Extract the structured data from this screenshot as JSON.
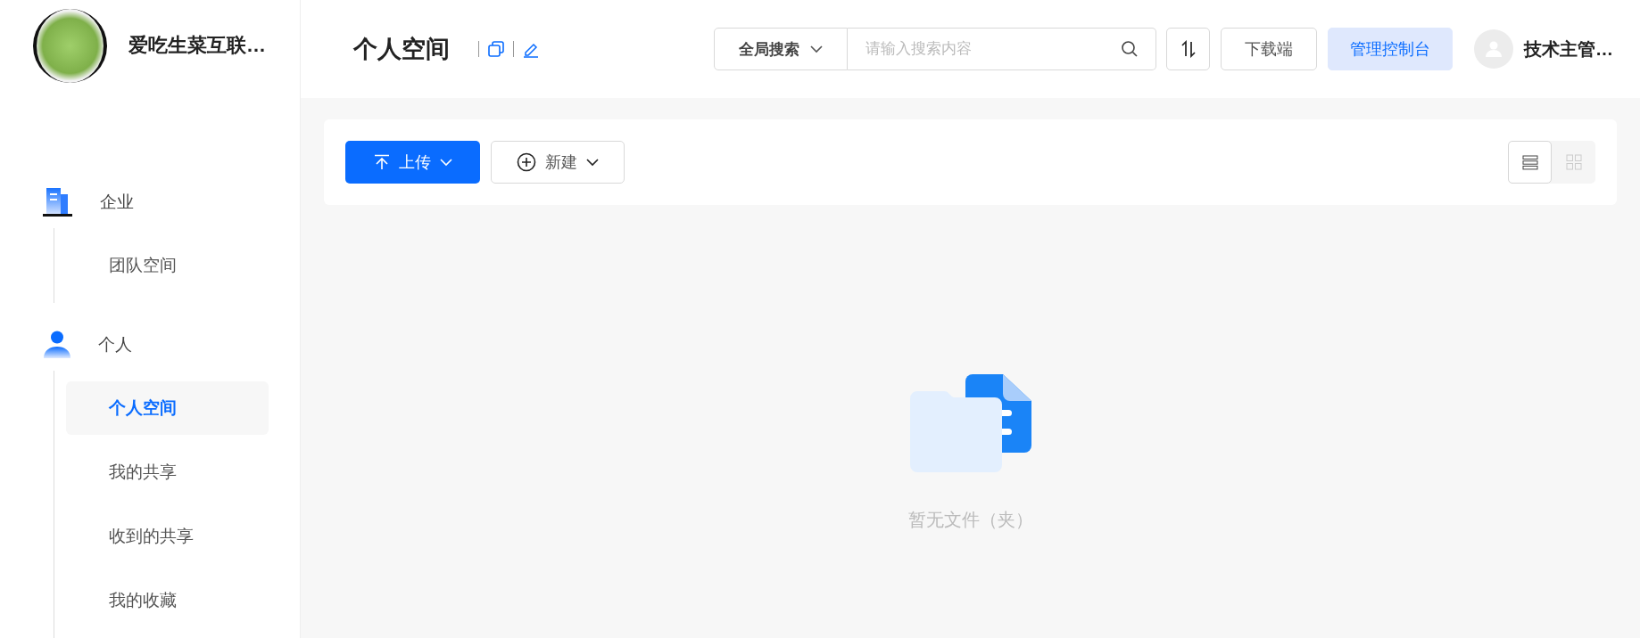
{
  "sidebar": {
    "org_name": "爱吃生菜互联…",
    "groups": [
      {
        "kind": "company",
        "label": "企业",
        "children": [
          {
            "label": "团队空间",
            "selected": false
          }
        ]
      },
      {
        "kind": "person",
        "label": "个人",
        "children": [
          {
            "label": "个人空间",
            "selected": true
          },
          {
            "label": "我的共享",
            "selected": false
          },
          {
            "label": "收到的共享",
            "selected": false
          },
          {
            "label": "我的收藏",
            "selected": false
          }
        ]
      }
    ]
  },
  "header": {
    "title": "个人空间",
    "search": {
      "scope": "全局搜索",
      "placeholder": "请输入搜索内容"
    },
    "download_button": "下载端",
    "console_button": "管理控制台",
    "user_name": "技术主管…"
  },
  "toolbar": {
    "upload_button": "上传",
    "new_button": "新建",
    "views": [
      {
        "kind": "list",
        "selected": true
      },
      {
        "kind": "grid",
        "selected": false
      }
    ]
  },
  "empty_state": {
    "message": "暂无文件（夹）"
  }
}
